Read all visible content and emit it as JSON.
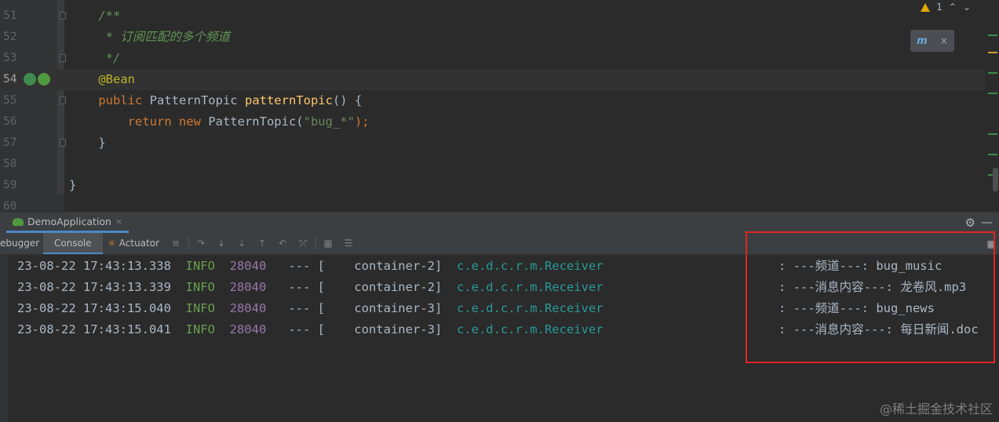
{
  "editor": {
    "lines": [
      {
        "num": "51",
        "parts": [
          {
            "t": "    /**",
            "c": "c-comment"
          }
        ]
      },
      {
        "num": "52",
        "parts": [
          {
            "t": "     * 订阅匹配的多个频道",
            "c": "c-comment"
          }
        ]
      },
      {
        "num": "53",
        "parts": [
          {
            "t": "     */",
            "c": "c-comment"
          }
        ]
      },
      {
        "num": "54",
        "parts": [
          {
            "t": "    @Bean",
            "c": "c-ann"
          }
        ]
      },
      {
        "num": "55",
        "parts": [
          {
            "t": "    public ",
            "c": "c-kw"
          },
          {
            "t": "PatternTopic ",
            "c": ""
          },
          {
            "t": "patternTopic",
            "c": "c-fn"
          },
          {
            "t": "() {",
            "c": ""
          }
        ]
      },
      {
        "num": "56",
        "parts": [
          {
            "t": "        return new ",
            "c": "c-kw"
          },
          {
            "t": "PatternTopic(",
            "c": ""
          },
          {
            "t": "\"bug_*\"",
            "c": "c-str"
          },
          {
            "t": ");",
            "c": "c-kw"
          }
        ]
      },
      {
        "num": "57",
        "parts": [
          {
            "t": "    }",
            "c": ""
          }
        ]
      },
      {
        "num": "58",
        "parts": []
      },
      {
        "num": "59",
        "parts": [
          {
            "t": "}",
            "c": ""
          }
        ]
      },
      {
        "num": "60",
        "parts": []
      }
    ],
    "inspection_count": "1",
    "maven_popup": {
      "icon": "maven-reload-icon",
      "close": "×"
    }
  },
  "run_panel": {
    "tab_label": "DemoApplication",
    "tab_close": "×",
    "tabs": {
      "debugger": "ebugger",
      "console": "Console",
      "actuator": "Actuator"
    }
  },
  "console": {
    "lines": [
      {
        "ts": "23-08-22 17:43:13.338",
        "level": "INFO",
        "pid": "28040",
        "sep": " --- [",
        "thread": "    container-2]",
        "logger": "c.e.d.c.r.m.Receiver",
        "msg": ": ---频道---: bug_music"
      },
      {
        "ts": "23-08-22 17:43:13.339",
        "level": "INFO",
        "pid": "28040",
        "sep": " --- [",
        "thread": "    container-2]",
        "logger": "c.e.d.c.r.m.Receiver",
        "msg": ": ---消息内容---: 龙卷风.mp3"
      },
      {
        "ts": "23-08-22 17:43:15.040",
        "level": "INFO",
        "pid": "28040",
        "sep": " --- [",
        "thread": "    container-3]",
        "logger": "c.e.d.c.r.m.Receiver",
        "msg": ": ---频道---: bug_news"
      },
      {
        "ts": "23-08-22 17:43:15.041",
        "level": "INFO",
        "pid": "28040",
        "sep": " --- [",
        "thread": "    container-3]",
        "logger": "c.e.d.c.r.m.Receiver",
        "msg": ": ---消息内容---: 每日新闻.doc"
      }
    ]
  },
  "watermark": "@稀土掘金技术社区",
  "colors": {
    "highlight_box": "#e02424",
    "accent_tab": "#4a88c7"
  }
}
